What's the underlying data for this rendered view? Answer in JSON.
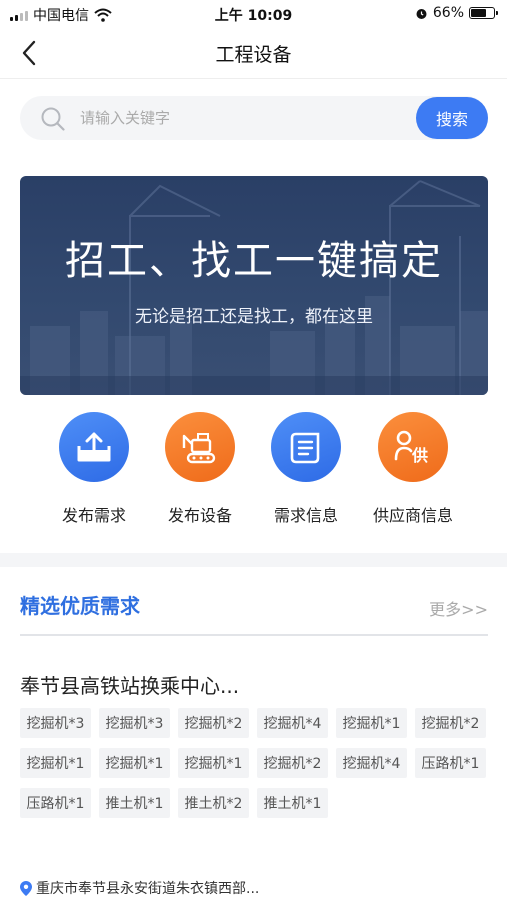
{
  "status_bar": {
    "carrier": "中国电信",
    "time": "上午 10:09",
    "battery": "66%",
    "battery_level": 0.66
  },
  "nav": {
    "title": "工程设备",
    "back_icon": "chevron-left-icon"
  },
  "search": {
    "placeholder": "请输入关键字",
    "button_label": "搜索",
    "icon": "search-icon"
  },
  "banner": {
    "title": "招工、找工一键搞定",
    "subtitle": "无论是招工还是找工，都在这里"
  },
  "quick_actions": [
    {
      "label": "发布需求",
      "icon": "upload-icon",
      "color": "#3d7bf3"
    },
    {
      "label": "发布设备",
      "icon": "excavator-icon",
      "color": "#f57a26"
    },
    {
      "label": "需求信息",
      "icon": "scroll-icon",
      "color": "#3d7bf3"
    },
    {
      "label": "供应商信息",
      "icon": "supplier-icon",
      "color": "#f57a26"
    }
  ],
  "featured": {
    "title": "精选优质需求",
    "more_label": "更多>>"
  },
  "demand": {
    "title": "奉节县高铁站换乘中心...",
    "tags": [
      "挖掘机*3",
      "挖掘机*3",
      "挖掘机*2",
      "挖掘机*4",
      "挖掘机*1",
      "挖掘机*2",
      "挖掘机*1",
      "挖掘机*1",
      "挖掘机*1",
      "挖掘机*2",
      "挖掘机*4",
      "压路机*1",
      "压路机*1",
      "推土机*1",
      "推土机*2",
      "推土机*1"
    ],
    "location": "重庆市奉节县永安街道朱衣镇西部...",
    "location_icon": "location-pin-icon"
  },
  "colors": {
    "accent": "#3d7bf3",
    "orange": "#f57a26",
    "section_title": "#2f6fe0"
  }
}
